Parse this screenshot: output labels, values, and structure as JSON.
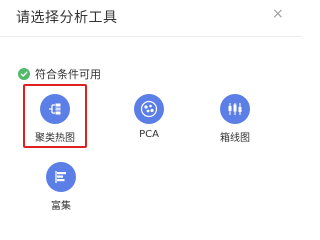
{
  "dialog": {
    "title": "请选择分析工具",
    "close_symbol": "×"
  },
  "section": {
    "label": "符合条件可用",
    "status_color": "#52b96b",
    "icon": "check-circle-icon"
  },
  "accent": "#5b7fe6",
  "selection_color": "#e02020",
  "tools": [
    {
      "label": "聚类热图",
      "icon": "cluster-heatmap-icon",
      "selected": true
    },
    {
      "label": "PCA",
      "icon": "pca-scatter-icon",
      "selected": false
    },
    {
      "label": "箱线图",
      "icon": "boxplot-icon",
      "selected": false
    },
    {
      "label": "富集",
      "icon": "enrichment-icon",
      "selected": false
    }
  ]
}
